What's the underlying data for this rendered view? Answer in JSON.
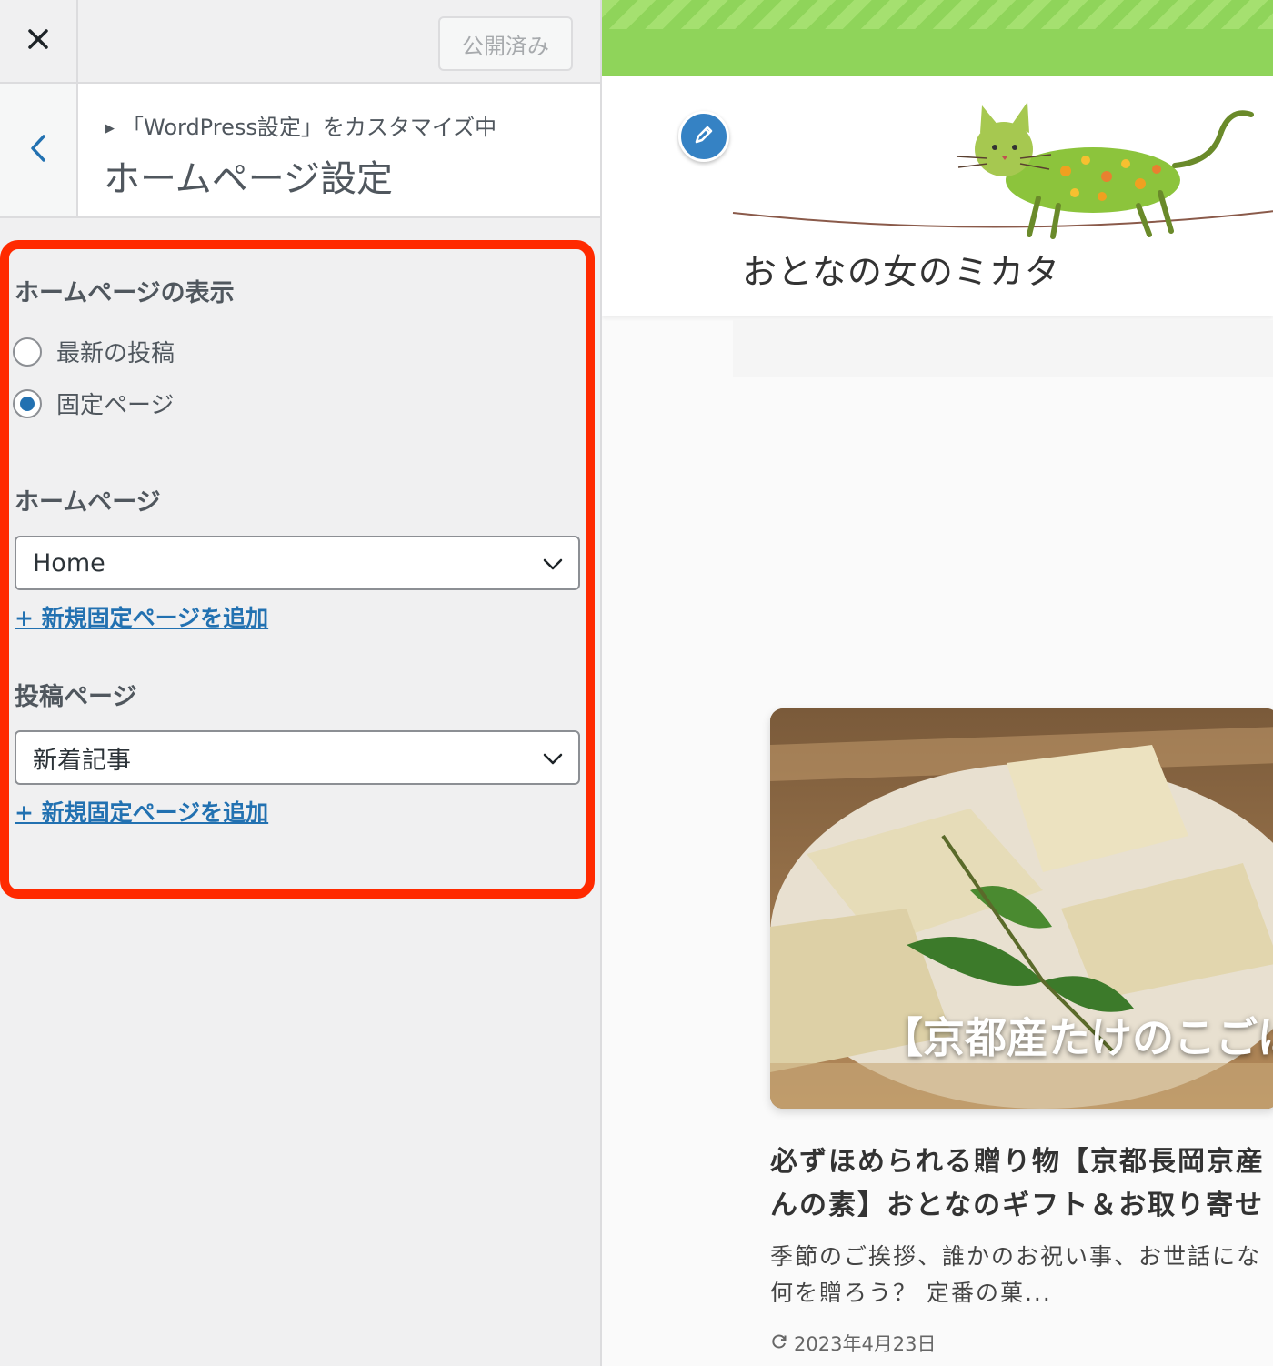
{
  "topbar": {
    "close_icon": "close-icon",
    "publish_label": "公開済み"
  },
  "section": {
    "back_icon": "chevron-left-icon",
    "breadcrumb": "「WordPress設定」をカスタマイズ中",
    "title": "ホームページ設定"
  },
  "homepage_display": {
    "title": "ホームページの表示",
    "options": [
      {
        "label": "最新の投稿",
        "checked": false
      },
      {
        "label": "固定ページ",
        "checked": true
      }
    ]
  },
  "homepage_select": {
    "title": "ホームページ",
    "value": "Home",
    "add_link": "+ 新規固定ページを追加"
  },
  "posts_select": {
    "title": "投稿ページ",
    "value": "新着記事",
    "add_link": "+ 新規固定ページを追加"
  },
  "highlight_color": "#ff2a00",
  "preview": {
    "accent_color": "#8fd45a",
    "edit_icon": "pencil-icon",
    "logo_icon": "cat-illustration-icon",
    "site_title": "おとなの女のミカタ",
    "card_image_text": "【京都産たけのこごは",
    "post_title_line1": "必ずほめられる贈り物【京都長岡京産",
    "post_title_line2": "んの素】おとなのギフト＆お取り寄せ",
    "excerpt_line1": "季節のご挨拶、誰かのお祝い事、お世話にな",
    "excerpt_line2": "何を贈ろう？ 定番の菓...",
    "date_icon": "refresh-icon",
    "date": "2023年4月23日"
  }
}
